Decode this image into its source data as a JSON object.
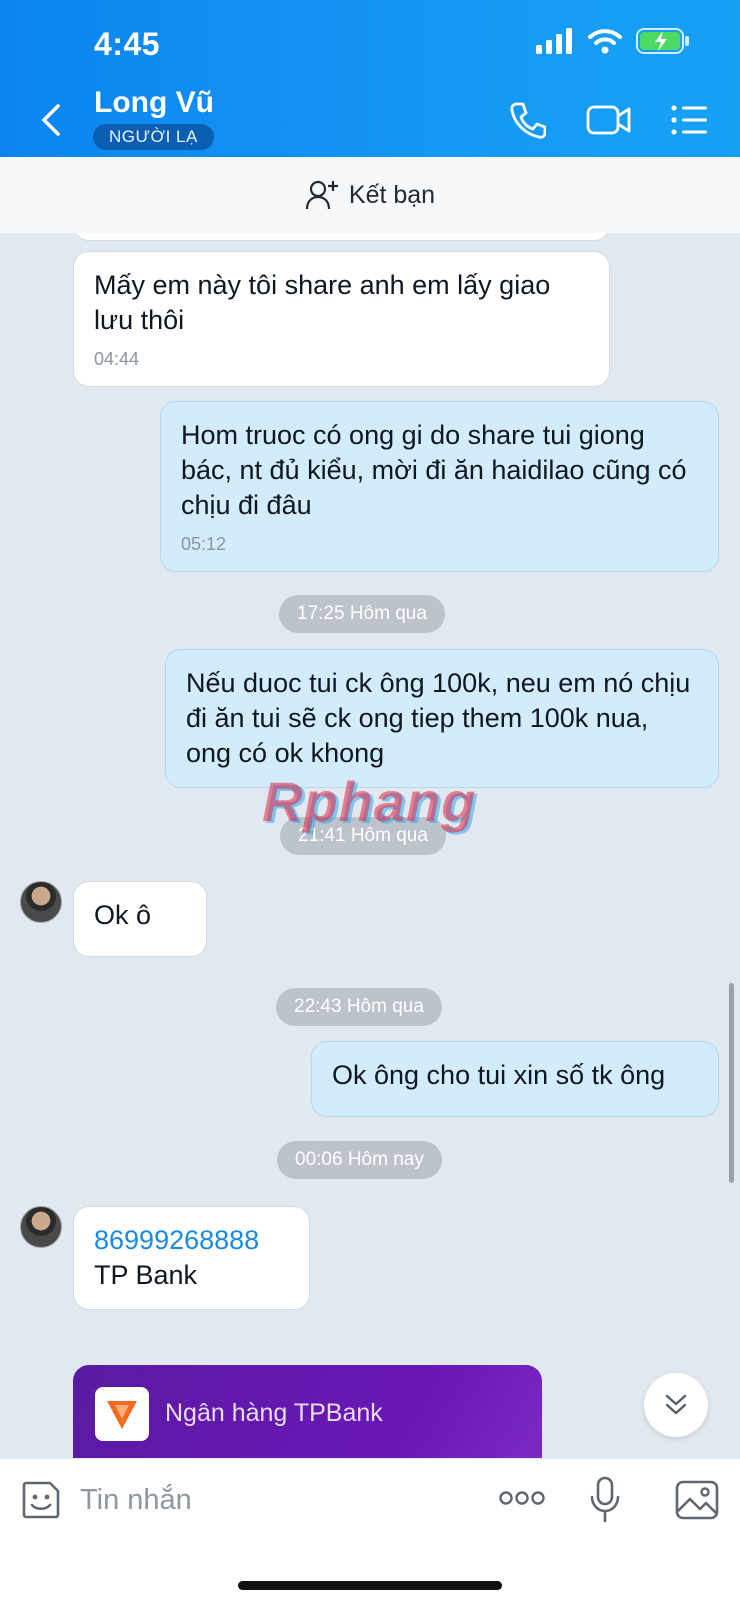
{
  "status": {
    "time": "4:45"
  },
  "header": {
    "name": "Long Vũ",
    "badge": "NGƯỜI LẠ"
  },
  "add_friend": {
    "label": "Kết bạn"
  },
  "messages": [
    {
      "text": "Mấy em này tôi share anh em lấy giao lưu thôi",
      "time": "04:44"
    },
    {
      "text": "Hom truoc có ong gi do share tui giong bác, nt đủ kiểu, mời đi ăn haidilao cũng có chịu đi đâu",
      "time": "05:12"
    },
    {
      "text": "Nếu duoc tui ck ông 100k, neu em nó chịu đi ăn tui sẽ ck ong tiep them 100k nua, ong có ok khong"
    },
    {
      "text": "Ok ô"
    },
    {
      "text": "Ok ông cho tui xin số tk ông"
    },
    {
      "account": "86999268888",
      "bank": "TP Bank"
    }
  ],
  "dividers": [
    "17:25 Hôm qua",
    "21:41 Hôm qua",
    "22:43 Hôm qua",
    "00:06 Hôm nay"
  ],
  "bank_card": {
    "name": "Ngân hàng TPBank",
    "brand_color": "#6a17b5",
    "logo_color": "#f26b21"
  },
  "watermark": "Rphang",
  "input": {
    "placeholder": "Tin nhắn"
  },
  "colors": {
    "header": "#1598f4",
    "outgoing_bubble": "#d3ecfb",
    "incoming_bubble": "#ffffff",
    "chat_bg": "#e2e8ef"
  }
}
